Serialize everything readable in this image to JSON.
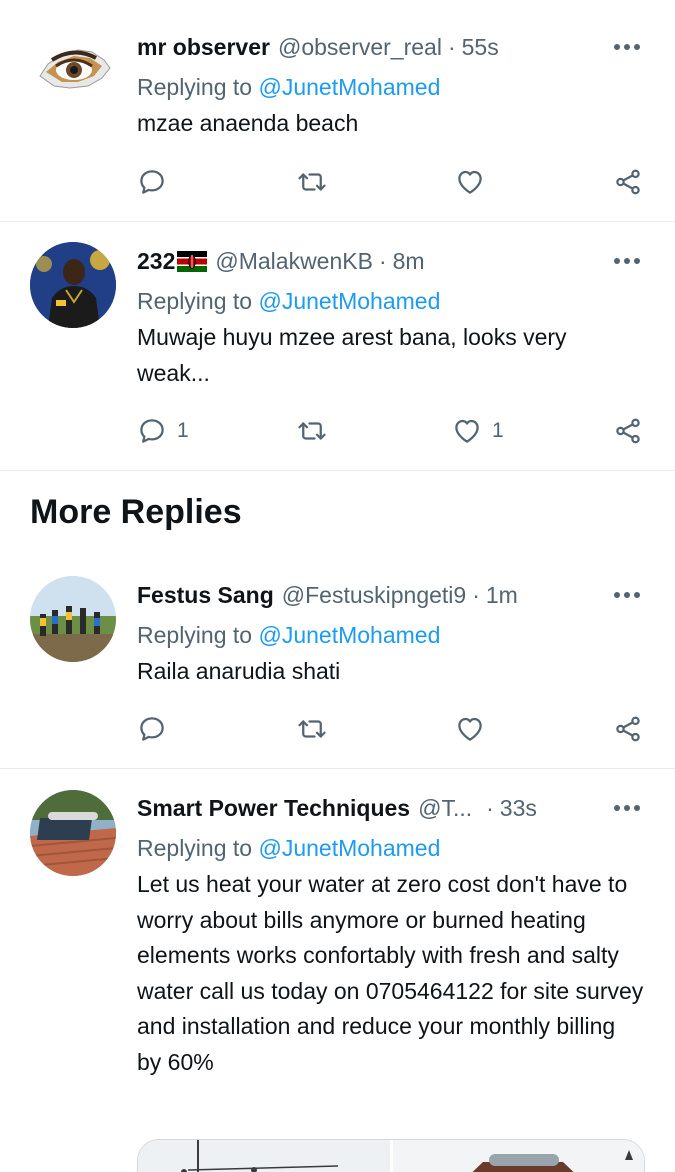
{
  "tweets": [
    {
      "name": "mr observer",
      "handle": "@observer_real",
      "time": "55s",
      "replying_label": "Replying to",
      "mention": "@JunetMohamed",
      "text": "mzae anaenda beach",
      "replies": "",
      "likes": ""
    },
    {
      "name": "232",
      "handle": "@MalakwenKB",
      "time": "8m",
      "replying_label": "Replying to",
      "mention": "@JunetMohamed",
      "text": "Muwaje huyu mzee arest bana, looks very weak...",
      "replies": "1",
      "likes": "1"
    },
    {
      "name": "Festus Sang",
      "handle": "@Festuskipngeti9",
      "time": "1m",
      "replying_label": "Replying to",
      "mention": "@JunetMohamed",
      "text": "Raila anarudia shati",
      "replies": "",
      "likes": ""
    },
    {
      "name": "Smart Power Techniques",
      "handle": "@T...",
      "time": "33s",
      "replying_label": "Replying to",
      "mention": "@JunetMohamed",
      "text": "Let us heat your water at zero cost don't have to worry about bills anymore or burned heating elements works confortably with fresh and salty water call us today on 0705464122 for site survey and installation and reduce your monthly billing by 60%"
    }
  ],
  "section_title": "More Replies",
  "colors": {
    "accent": "#1d9bf0",
    "secondary_text": "#536471",
    "divider": "#e6ecf0"
  },
  "icons": [
    "reply-icon",
    "retweet-icon",
    "like-icon",
    "share-icon",
    "more-icon",
    "kenya-flag-icon"
  ]
}
